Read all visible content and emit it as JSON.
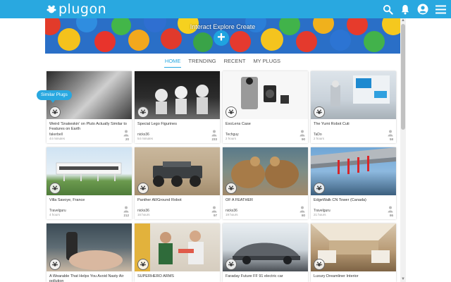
{
  "header": {
    "logo_text": "plugon",
    "brand_color": "#29a8e0",
    "icons": [
      "search-icon",
      "bell-icon",
      "account-icon",
      "menu-icon"
    ]
  },
  "hero": {
    "title": "Interact Explore Create",
    "plus_label": "+"
  },
  "tabs": [
    {
      "label": "HOME",
      "active": true
    },
    {
      "label": "TRENDING",
      "active": false
    },
    {
      "label": "RECENT",
      "active": false
    },
    {
      "label": "MY PLUGS",
      "active": false
    }
  ],
  "tooltip": "Similar Plugs",
  "cards": [
    {
      "title": "Weird 'Snakeskin' on Pluto Actually Similar to Features on Earth",
      "author": "fakerbell",
      "time": "44 minutes",
      "count": "20"
    },
    {
      "title": "Special Lego Figurines",
      "author": "nicks36",
      "time": "54 minutes",
      "count": "233"
    },
    {
      "title": "ExoLens Case",
      "author": "Techguy",
      "time": "2 hours",
      "count": "90"
    },
    {
      "title": "The Yumi Robot Cuti",
      "author": "TaDo",
      "time": "2 hours",
      "count": "58"
    },
    {
      "title": "Villa Savoye, France",
      "author": "Travelguru",
      "time": "4 hours",
      "count": "212"
    },
    {
      "title": "Panther All/Ground Robot",
      "author": "nicks36",
      "time": "16 hours",
      "count": "97"
    },
    {
      "title": "OF A FEATHER",
      "author": "nicks36",
      "time": "19 hours",
      "count": "80"
    },
    {
      "title": "EdgeWalk CN Tower (Canada)",
      "author": "Travelguru",
      "time": "21 hours",
      "count": "86"
    },
    {
      "title": "A Wearable That Helps You Avoid Nasty Air pollution",
      "author": "",
      "time": "",
      "count": ""
    },
    {
      "title": "SUPERHERO ARMS",
      "author": "",
      "time": "",
      "count": ""
    },
    {
      "title": "Faraday Future FF 91 electric car",
      "author": "",
      "time": "",
      "count": ""
    },
    {
      "title": "Luxury Dreamliner Interior",
      "author": "",
      "time": "",
      "count": ""
    }
  ]
}
